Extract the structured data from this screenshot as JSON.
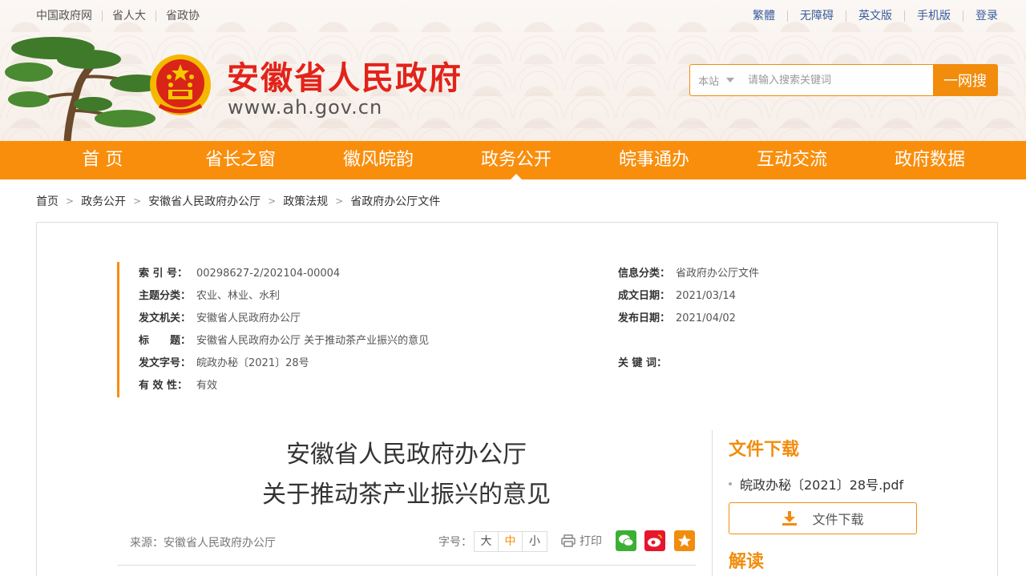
{
  "top_links_left": [
    "中国政府网",
    "省人大",
    "省政协"
  ],
  "top_links_right": [
    "繁體",
    "无障碍",
    "英文版",
    "手机版",
    "登录"
  ],
  "site": {
    "title": "安徽省人民政府",
    "url": "www.ah.gov.cn"
  },
  "search": {
    "scope": "本站",
    "placeholder": "请输入搜索关键词",
    "button": "一网搜"
  },
  "nav": [
    "首 页",
    "省长之窗",
    "徽风皖韵",
    "政务公开",
    "皖事通办",
    "互动交流",
    "政府数据"
  ],
  "nav_active_index": 3,
  "breadcrumb": [
    "首页",
    "政务公开",
    "安徽省人民政府办公厅",
    "政策法规",
    "省政府办公厅文件"
  ],
  "meta": {
    "index_label": "索 引 号：",
    "index_value": "00298627-2/202104-00004",
    "category_label": "信息分类：",
    "category_value": "省政府办公厅文件",
    "topic_label": "主题分类：",
    "topic_value": "农业、林业、水利",
    "created_label": "成文日期：",
    "created_value": "2021/03/14",
    "issuer_label": "发文机关：",
    "issuer_value": "安徽省人民政府办公厅",
    "published_label": "发布日期：",
    "published_value": "2021/04/02",
    "title_label": "标　　题：",
    "title_value": "安徽省人民政府办公厅 关于推动茶产业振兴的意见",
    "docno_label": "发文字号：",
    "docno_value": "皖政办秘〔2021〕28号",
    "keywords_label": "关 键 词：",
    "keywords_value": "",
    "validity_label": "有 效 性：",
    "validity_value": "有效"
  },
  "article": {
    "title_line1": "安徽省人民政府办公厅",
    "title_line2": "关于推动茶产业振兴的意见",
    "source": "来源：安徽省人民政府办公厅",
    "fontsize_label": "字号：",
    "fontsize_options": [
      "大",
      "中",
      "小"
    ],
    "fontsize_selected": "中",
    "print_label": "打印"
  },
  "side": {
    "download_heading": "文件下载",
    "file_name": "皖政办秘〔2021〕28号.pdf",
    "download_button": "文件下载",
    "interpretation_heading": "解读"
  },
  "colors": {
    "accent": "#f98e0c",
    "title_red": "#e2231a",
    "link_blue": "#3a5d9c"
  }
}
